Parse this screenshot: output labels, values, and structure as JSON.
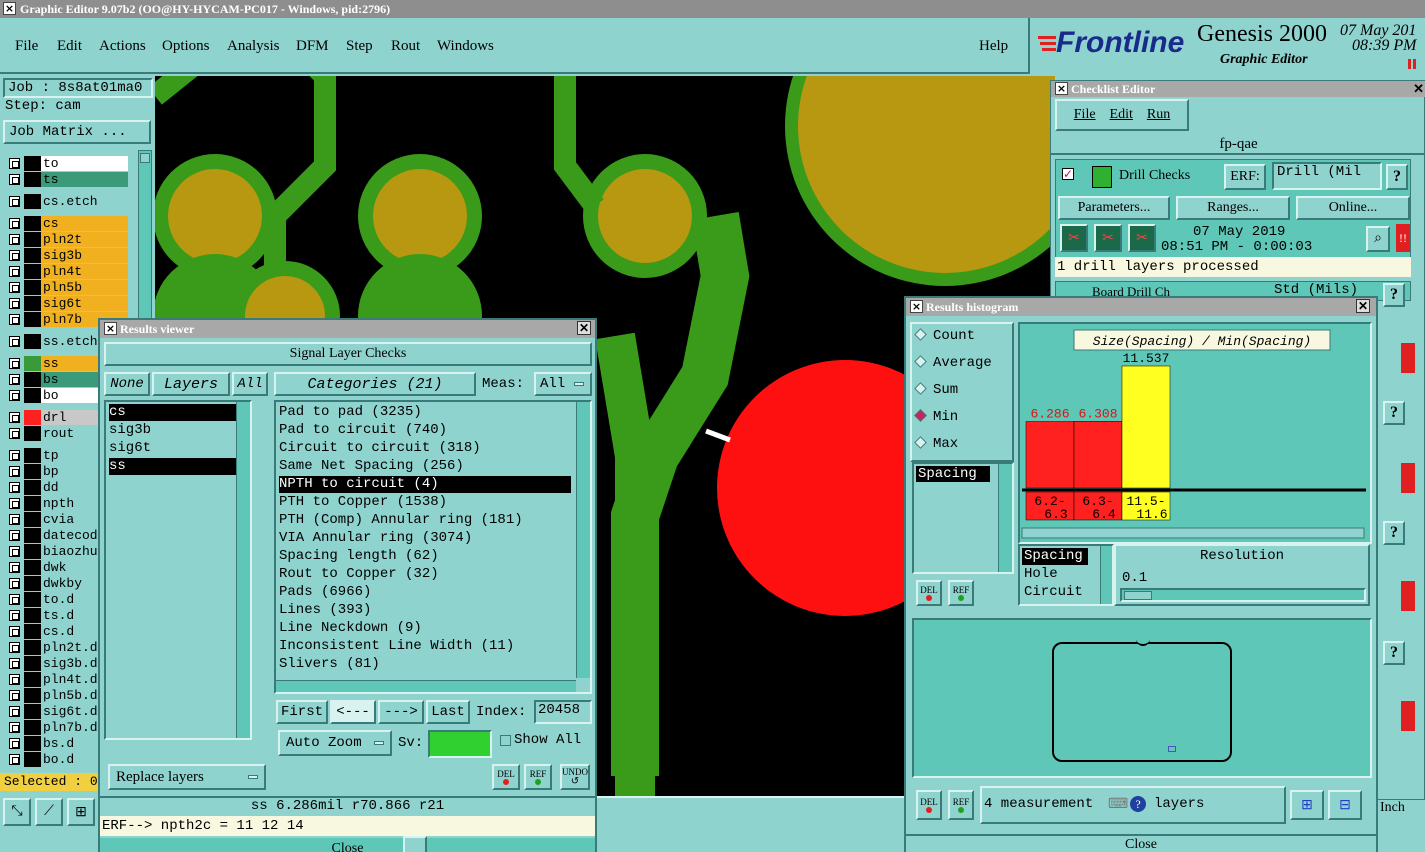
{
  "titlebar": {
    "title": "Graphic Editor 9.07b2 (OO@HY-HYCAM-PC017 - Windows, pid:2796)"
  },
  "menu": {
    "items": [
      "File",
      "Edit",
      "Actions",
      "Options",
      "Analysis",
      "DFM",
      "Step",
      "Rout",
      "Windows"
    ],
    "help": "Help"
  },
  "brand": {
    "logo": "Frontline",
    "product": "Genesis 2000",
    "subtitle": "Graphic Editor",
    "date": "07 May 201",
    "time": "08:39 PM"
  },
  "job": {
    "job": "Job : 8s8at01ma0",
    "step": "Step: cam",
    "matrix": "Job Matrix ..."
  },
  "layers": [
    {
      "name": "to",
      "color": "#ffffff",
      "sw": "#000000"
    },
    {
      "name": "ts",
      "color": "#3a9a7a",
      "sw": "#000000"
    },
    {
      "name": "cs.etch",
      "color": "#8fd3cf",
      "sw": "#000000"
    },
    {
      "name": "cs",
      "color": "#f0b020",
      "sw": "#000000"
    },
    {
      "name": "pln2t",
      "color": "#f0b020",
      "sw": "#000000"
    },
    {
      "name": "sig3b",
      "color": "#f0b020",
      "sw": "#000000"
    },
    {
      "name": "pln4t",
      "color": "#f0b020",
      "sw": "#000000"
    },
    {
      "name": "pln5b",
      "color": "#f0b020",
      "sw": "#000000"
    },
    {
      "name": "sig6t",
      "color": "#f0b020",
      "sw": "#000000"
    },
    {
      "name": "pln7b",
      "color": "#f0b020",
      "sw": "#000000"
    },
    {
      "name": "ss.etch",
      "color": "#8fd3cf",
      "sw": "#000000"
    },
    {
      "name": "ss",
      "color": "#f0b020",
      "sw": "#3a9a3a"
    },
    {
      "name": "bs",
      "color": "#3a9a7a",
      "sw": "#000000"
    },
    {
      "name": "bo",
      "color": "#ffffff",
      "sw": "#000000"
    },
    {
      "name": "drl",
      "color": "#c8c8c8",
      "sw": "#ff2020"
    },
    {
      "name": "rout",
      "color": "#8fd3cf",
      "sw": "#000000"
    },
    {
      "name": "tp",
      "color": "#8fd3cf",
      "sw": "#000000"
    },
    {
      "name": "bp",
      "color": "#8fd3cf",
      "sw": "#000000"
    },
    {
      "name": "dd",
      "color": "#8fd3cf",
      "sw": "#000000"
    },
    {
      "name": "npth",
      "color": "#8fd3cf",
      "sw": "#000000"
    },
    {
      "name": "cvia",
      "color": "#8fd3cf",
      "sw": "#000000"
    },
    {
      "name": "datecode",
      "color": "#8fd3cf",
      "sw": "#000000"
    },
    {
      "name": "biaozhu",
      "color": "#8fd3cf",
      "sw": "#000000"
    },
    {
      "name": "dwk",
      "color": "#8fd3cf",
      "sw": "#000000"
    },
    {
      "name": "dwkby",
      "color": "#8fd3cf",
      "sw": "#000000"
    },
    {
      "name": "to.d",
      "color": "#8fd3cf",
      "sw": "#000000"
    },
    {
      "name": "ts.d",
      "color": "#8fd3cf",
      "sw": "#000000"
    },
    {
      "name": "cs.d",
      "color": "#8fd3cf",
      "sw": "#000000"
    },
    {
      "name": "pln2t.d",
      "color": "#8fd3cf",
      "sw": "#000000"
    },
    {
      "name": "sig3b.d",
      "color": "#8fd3cf",
      "sw": "#000000"
    },
    {
      "name": "pln4t.d",
      "color": "#8fd3cf",
      "sw": "#000000"
    },
    {
      "name": "pln5b.d",
      "color": "#8fd3cf",
      "sw": "#000000"
    },
    {
      "name": "sig6t.d",
      "color": "#8fd3cf",
      "sw": "#000000"
    },
    {
      "name": "pln7b.d",
      "color": "#8fd3cf",
      "sw": "#000000"
    },
    {
      "name": "bs.d",
      "color": "#8fd3cf",
      "sw": "#000000"
    },
    {
      "name": "bo.d",
      "color": "#8fd3cf",
      "sw": "#000000"
    }
  ],
  "selected": "Selected : 0",
  "results_viewer": {
    "title": "Results viewer",
    "heading": "Signal Layer Checks",
    "none": "None",
    "layers_label": "Layers",
    "all": "All",
    "categories_label": "Categories (21)",
    "meas": "Meas:",
    "meas_value": "All",
    "layers": [
      "cs",
      "sig3b",
      "sig6t",
      "ss"
    ],
    "categories": [
      "Pad to pad (3235)",
      "Pad to circuit (740)",
      "Circuit to circuit (318)",
      "Same Net Spacing (256)",
      "NPTH to circuit (4)",
      "PTH to Copper (1538)",
      "PTH (Comp) Annular ring (181)",
      "VIA Annular ring (3074)",
      "Spacing length (62)",
      "Rout to Copper (32)",
      "Pads (6966)",
      "Lines (393)",
      "Line Neckdown (9)",
      "Inconsistent Line Width (11)",
      "Slivers (81)"
    ],
    "selected_category": "NPTH to circuit (4)",
    "first": "First",
    "prev": "<---",
    "next": "--->",
    "last": "Last",
    "index_label": "Index:",
    "index_value": "20458",
    "auto_zoom": "Auto Zoom",
    "sv": "Sv:",
    "show_all": "Show All",
    "replace_layers": "Replace layers",
    "del": "DEL",
    "ref": "REF",
    "undo": "UNDO",
    "status": "ss 6.286mil  r70.866  r21",
    "erf": "ERF--> npth2c = 11 12 14",
    "close": "Close"
  },
  "checklist": {
    "title": "Checklist Editor",
    "menu": [
      "File",
      "Edit",
      "Run"
    ],
    "name": "fp-qae",
    "check_name": "Drill Checks",
    "erf_label": "ERF:",
    "erf_value": "Drill (Mil",
    "parameters": "Parameters...",
    "ranges": "Ranges...",
    "online": "Online...",
    "date": "07 May 2019",
    "time": "08:51 PM - 0:00:03",
    "processed": "1 drill layers processed",
    "check2_name": "Board Drill Ch",
    "erf2_value": "Std (Mils)",
    "help": "?"
  },
  "histogram": {
    "title": "Results histogram",
    "modes": [
      "Count",
      "Average",
      "Sum",
      "Min",
      "Max"
    ],
    "selected_mode": "Min",
    "chart_title": "Size(Spacing) / Min(Spacing)",
    "list_item": "Spacing",
    "resolution_label": "Resolution",
    "resolution_value": "0.1",
    "types": [
      "Spacing",
      "Hole",
      "Circuit"
    ],
    "measurement_text": "4 measurement",
    "layers_text": "layers",
    "close": "Close",
    "inch": "Inch"
  },
  "chart_data": {
    "type": "bar",
    "title": "Size(Spacing) / Min(Spacing)",
    "categories": [
      "6.2-6.3",
      "6.3-6.4",
      "11.5-11.6"
    ],
    "values": [
      6.286,
      6.308,
      11.537
    ],
    "value_labels": [
      "6.286",
      "6.308",
      "11.537"
    ],
    "colors": [
      "#ff2020",
      "#ff2020",
      "#ffff20"
    ]
  }
}
